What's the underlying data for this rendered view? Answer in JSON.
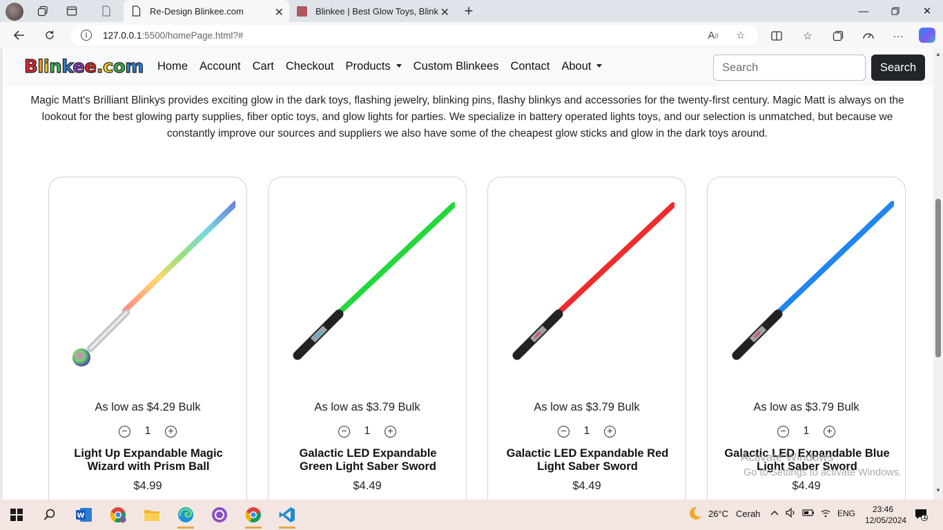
{
  "browser": {
    "tabs": [
      {
        "title": "Re-Design Blinkee.com",
        "active": true
      },
      {
        "title": "Blinkee | Best Glow Toys, Blinkee",
        "active": false
      }
    ],
    "url_host": "127.0.0.1",
    "url_path": ":5500/homePage.html?#"
  },
  "site": {
    "logo": "Blinkee.com",
    "nav": {
      "home": "Home",
      "account": "Account",
      "cart": "Cart",
      "checkout": "Checkout",
      "products": "Products",
      "custom": "Custom Blinkees",
      "contact": "Contact",
      "about": "About"
    },
    "search_placeholder": "Search",
    "search_button": "Search"
  },
  "intro": "Magic Matt's Brilliant Blinkys provides exciting glow in the dark toys, flashing jewelry, blinking pins, flashy blinkys and accessories for the twenty-first century. Magic Matt is always on the lookout for the best glowing party supplies, fiber optic toys, and glow lights for parties. We specialize in battery operated lights toys, and our selection is unmatched, but because we constantly improve our sources and suppliers we also have some of the cheapest glow sticks and glow in the dark toys around.",
  "products": [
    {
      "bulk": "As low as $4.29 Bulk",
      "qty": "1",
      "name": "Light Up Expandable Magic Wizard with Prism Ball",
      "price": "$4.99"
    },
    {
      "bulk": "As low as $3.79 Bulk",
      "qty": "1",
      "name": "Galactic LED Expandable Green Light Saber Sword",
      "price": "$4.49"
    },
    {
      "bulk": "As low as $3.79 Bulk",
      "qty": "1",
      "name": "Galactic LED Expandable Red Light Saber Sword",
      "price": "$4.49"
    },
    {
      "bulk": "As low as $3.79 Bulk",
      "qty": "1",
      "name": "Galactic LED Expandable Blue Light Saber Sword",
      "price": "$4.49"
    }
  ],
  "watermark": {
    "line1": "Activate Windows",
    "line2": "Go to Settings to activate Windows."
  },
  "taskbar": {
    "weather": "26°C",
    "weather_text": "Cerah",
    "lang": "ENG",
    "time": "23:46",
    "date": "12/05/2024",
    "notifications": "1"
  },
  "colors": {
    "accent_dark": "#212529",
    "navbar_bg": "#f8f9fa"
  }
}
